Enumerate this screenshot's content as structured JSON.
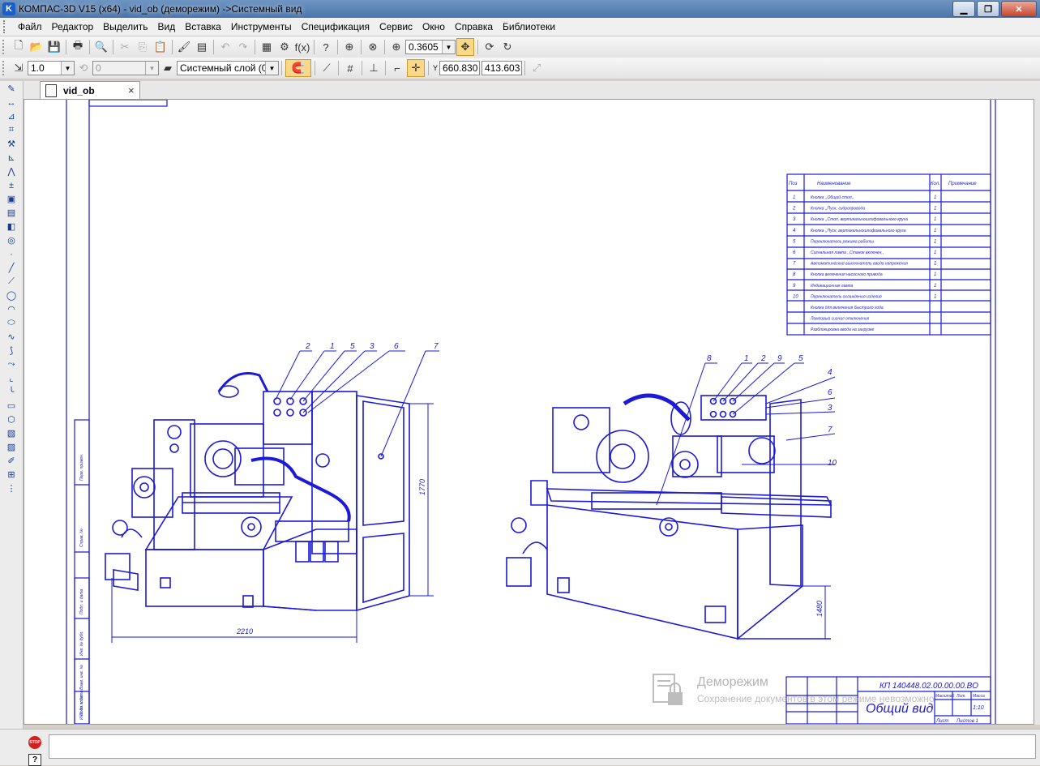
{
  "window": {
    "title": "КОМПАС-3D V15 (x64) - vid_ob (деморежим) ->Системный вид",
    "app_icon_letter": "K"
  },
  "menu": [
    "Файл",
    "Редактор",
    "Выделить",
    "Вид",
    "Вставка",
    "Инструменты",
    "Спецификация",
    "Сервис",
    "Окно",
    "Справка",
    "Библиотеки"
  ],
  "toolbar1": {
    "zoom_value": "0.3605"
  },
  "toolbar2": {
    "line_scale": "1.0",
    "angle_value": "0",
    "layer_value": "Системный слой (0)",
    "coord_x": "660.830",
    "coord_y": "413.603",
    "y_label": "Y"
  },
  "tab": {
    "label": "vid_ob",
    "close": "×"
  },
  "drawing": {
    "dim_width": "2210",
    "dim_height_left": "1770",
    "dim_height_right": "1480",
    "left_callouts": [
      "2",
      "1",
      "5",
      "3",
      "6",
      "7"
    ],
    "right_callouts": [
      "8",
      "1",
      "2",
      "9",
      "5",
      "4",
      "6",
      "3",
      "7",
      "10"
    ],
    "spec_table": {
      "headers": [
        "Поз",
        "Наименование",
        "Кол.",
        "Примечание"
      ],
      "rows": [
        [
          "1",
          "Кнопка ,,Общий стоп,,",
          "1",
          ""
        ],
        [
          "2",
          "Кнопка ,,Пуск, гидропривода",
          "1",
          ""
        ],
        [
          "3",
          "Кнопка ,,Стоп, вертикальношлифовального круга",
          "1",
          ""
        ],
        [
          "4",
          "Кнопка ,,Пуск, вертикальношлифовального круга",
          "1",
          ""
        ],
        [
          "5",
          "Переключатель режима работы",
          "1",
          ""
        ],
        [
          "6",
          "Сигнальная лампа ,,Станок включен,,",
          "1",
          ""
        ],
        [
          "7",
          "Автоматический выключатель ввода напряжения",
          "1",
          ""
        ],
        [
          "8",
          "Кнопка включения насосного привода",
          "1",
          ""
        ],
        [
          "9",
          "Индикационная лампа",
          "1",
          ""
        ],
        [
          "10",
          "Переключатель охлаждения изделия",
          "1",
          ""
        ],
        [
          "",
          "Кнопка для включения быстрого хода",
          "",
          ""
        ],
        [
          "",
          "Ламповый сигнал отключения",
          "",
          ""
        ],
        [
          "",
          "Разблокировка ввода на загрузке",
          "",
          ""
        ]
      ]
    },
    "title_block": {
      "doc_code": "КП 140448.02.00.00.00.ВО",
      "name": "Общий вид",
      "scale": "1:10",
      "lit_header": "Лит.",
      "mass_header": "Масса",
      "scale_header": "Масштаб",
      "sheet": "Лист",
      "sheets": "Листов 1"
    },
    "left_strip_labels": [
      "Перв. примен.",
      "Справ. №",
      "Подп. и дата",
      "Инв. № дубл.",
      "Взам. инв. №",
      "Подп. и дата",
      "Инв. № подл."
    ]
  },
  "demo": {
    "title": "Деморежим",
    "subtitle": "Сохранение документов в этом режиме невозможно"
  },
  "status": {
    "stop_label": "STOP",
    "help_label": "?"
  },
  "colors": {
    "drawing_line": "#1a1ad8",
    "frame": "#1a1ad8"
  }
}
